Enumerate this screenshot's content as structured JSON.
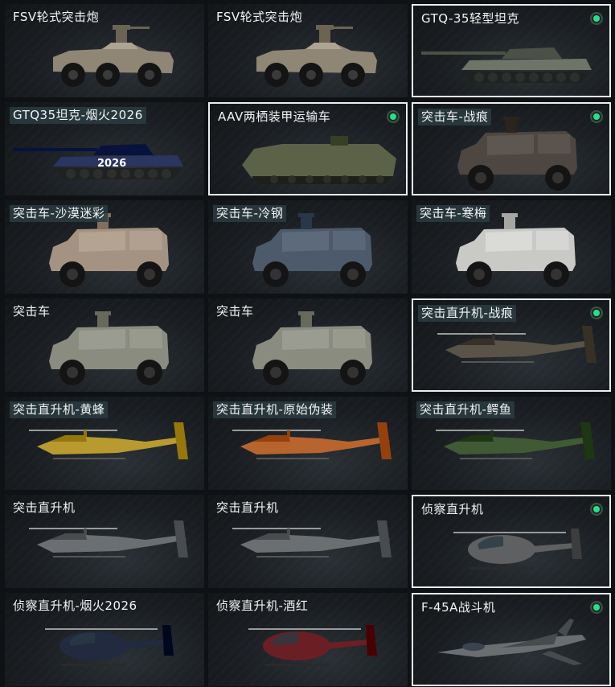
{
  "vehicles": [
    {
      "name": "FSV轮式突击炮",
      "kind": "fsv",
      "paint": "#8f8676",
      "tagged": false,
      "selected": false,
      "dot": false
    },
    {
      "name": "FSV轮式突击炮",
      "kind": "fsv",
      "paint": "#8f8676",
      "tagged": false,
      "selected": false,
      "dot": false
    },
    {
      "name": "GTQ-35轻型坦克",
      "kind": "tank",
      "paint": "#6f7468",
      "tagged": false,
      "selected": true,
      "dot": true
    },
    {
      "name": "GTQ35坦克-烟火2026",
      "kind": "tank2",
      "paint": "#2a3560",
      "tagged": true,
      "selected": false,
      "dot": false,
      "decal": "2026"
    },
    {
      "name": "AAV两栖装甲运输车",
      "kind": "aav",
      "paint": "#5b6248",
      "tagged": false,
      "selected": true,
      "dot": true
    },
    {
      "name": "突击车-战痕",
      "kind": "mrap",
      "paint": "#4e4640",
      "tagged": true,
      "selected": true,
      "dot": true
    },
    {
      "name": "突击车-沙漠迷彩",
      "kind": "mrap",
      "paint": "#a49382",
      "tagged": true,
      "selected": false,
      "dot": false
    },
    {
      "name": "突击车-冷钢",
      "kind": "mrap",
      "paint": "#4c5a6b",
      "tagged": true,
      "selected": false,
      "dot": false
    },
    {
      "name": "突击车-寒梅",
      "kind": "mrap",
      "paint": "#c9c9c6",
      "tagged": true,
      "selected": false,
      "dot": false
    },
    {
      "name": "突击车",
      "kind": "mrap",
      "paint": "#8a8c80",
      "tagged": false,
      "selected": false,
      "dot": false
    },
    {
      "name": "突击车",
      "kind": "mrap",
      "paint": "#8a8c80",
      "tagged": false,
      "selected": false,
      "dot": false
    },
    {
      "name": "突击直升机-战痕",
      "kind": "heli",
      "paint": "#5a5448",
      "tagged": true,
      "selected": true,
      "dot": true
    },
    {
      "name": "突击直升机-黄蜂",
      "kind": "heli",
      "paint": "#b89a2e",
      "tagged": true,
      "selected": false,
      "dot": false
    },
    {
      "name": "突击直升机-原始伪装",
      "kind": "heli",
      "paint": "#b8642e",
      "tagged": true,
      "selected": false,
      "dot": false
    },
    {
      "name": "突击直升机-鳄鱼",
      "kind": "heli",
      "paint": "#3f5a34",
      "tagged": true,
      "selected": false,
      "dot": false
    },
    {
      "name": "突击直升机",
      "kind": "heli",
      "paint": "#6c6f72",
      "tagged": false,
      "selected": false,
      "dot": false
    },
    {
      "name": "突击直升机",
      "kind": "heli",
      "paint": "#6c6f72",
      "tagged": false,
      "selected": false,
      "dot": false
    },
    {
      "name": "侦察直升机",
      "kind": "scout",
      "paint": "#5f6062",
      "tagged": false,
      "selected": true,
      "dot": true
    },
    {
      "name": "侦察直升机-烟火2026",
      "kind": "scout",
      "paint": "#222a40",
      "tagged": false,
      "selected": false,
      "dot": false
    },
    {
      "name": "侦察直升机-酒红",
      "kind": "scout",
      "paint": "#6a1f24",
      "tagged": false,
      "selected": false,
      "dot": false
    },
    {
      "name": "F-45A战斗机",
      "kind": "jet",
      "paint": "#6a6e70",
      "tagged": false,
      "selected": true,
      "dot": true
    }
  ],
  "colors": {
    "selected_border": "#e9edf0",
    "owned_dot": "#27e08a",
    "title_tag_bg": "#2a3c42"
  }
}
